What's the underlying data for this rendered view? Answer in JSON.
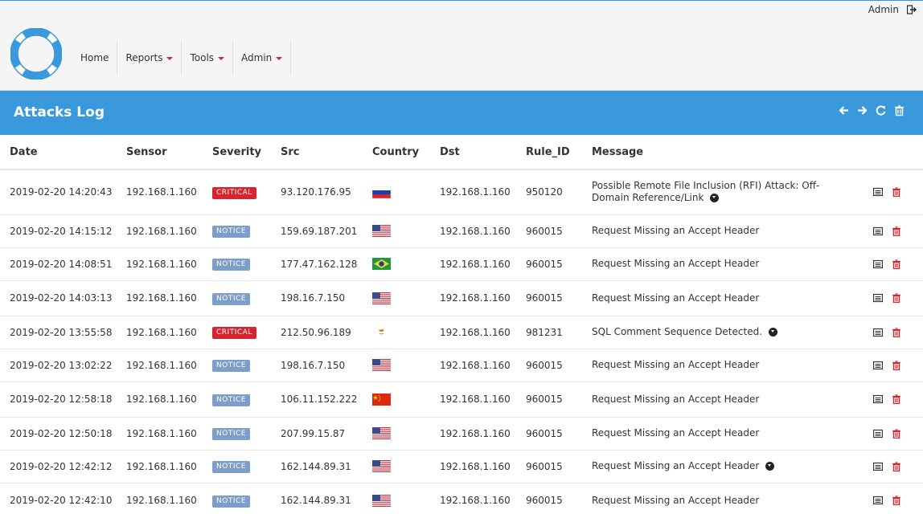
{
  "header": {
    "user": "Admin",
    "nav": [
      {
        "label": "Home",
        "dropdown": false
      },
      {
        "label": "Reports",
        "dropdown": true
      },
      {
        "label": "Tools",
        "dropdown": true
      },
      {
        "label": "Admin",
        "dropdown": true
      }
    ]
  },
  "panel": {
    "title": "Attacks Log",
    "tools": [
      "arrow-left-icon",
      "arrow-right-icon",
      "refresh-icon",
      "trash-icon"
    ]
  },
  "table": {
    "columns": [
      "Date",
      "Sensor",
      "Severity",
      "Src",
      "Country",
      "Dst",
      "Rule_ID",
      "Message"
    ],
    "rows": [
      {
        "date": "2019-02-20 14:20:43",
        "sensor": "192.168.1.160",
        "severity": "CRITICAL",
        "src": "93.120.176.95",
        "country": "ru",
        "dst": "192.168.1.160",
        "rule": "950120",
        "message": "Possible Remote File Inclusion (RFI) Attack: Off-Domain Reference/Link",
        "expand": true
      },
      {
        "date": "2019-02-20 14:15:12",
        "sensor": "192.168.1.160",
        "severity": "NOTICE",
        "src": "159.69.187.201",
        "country": "us",
        "dst": "192.168.1.160",
        "rule": "960015",
        "message": "Request Missing an Accept Header",
        "expand": false
      },
      {
        "date": "2019-02-20 14:08:51",
        "sensor": "192.168.1.160",
        "severity": "NOTICE",
        "src": "177.47.162.128",
        "country": "br",
        "dst": "192.168.1.160",
        "rule": "960015",
        "message": "Request Missing an Accept Header",
        "expand": false
      },
      {
        "date": "2019-02-20 14:03:13",
        "sensor": "192.168.1.160",
        "severity": "NOTICE",
        "src": "198.16.7.150",
        "country": "us",
        "dst": "192.168.1.160",
        "rule": "960015",
        "message": "Request Missing an Accept Header",
        "expand": false
      },
      {
        "date": "2019-02-20 13:55:58",
        "sensor": "192.168.1.160",
        "severity": "CRITICAL",
        "src": "212.50.96.189",
        "country": "cy",
        "dst": "192.168.1.160",
        "rule": "981231",
        "message": "SQL Comment Sequence Detected.",
        "expand": true
      },
      {
        "date": "2019-02-20 13:02:22",
        "sensor": "192.168.1.160",
        "severity": "NOTICE",
        "src": "198.16.7.150",
        "country": "us",
        "dst": "192.168.1.160",
        "rule": "960015",
        "message": "Request Missing an Accept Header",
        "expand": false
      },
      {
        "date": "2019-02-20 12:58:18",
        "sensor": "192.168.1.160",
        "severity": "NOTICE",
        "src": "106.11.152.222",
        "country": "cn",
        "dst": "192.168.1.160",
        "rule": "960015",
        "message": "Request Missing an Accept Header",
        "expand": false
      },
      {
        "date": "2019-02-20 12:50:18",
        "sensor": "192.168.1.160",
        "severity": "NOTICE",
        "src": "207.99.15.87",
        "country": "us",
        "dst": "192.168.1.160",
        "rule": "960015",
        "message": "Request Missing an Accept Header",
        "expand": false
      },
      {
        "date": "2019-02-20 12:42:12",
        "sensor": "192.168.1.160",
        "severity": "NOTICE",
        "src": "162.144.89.31",
        "country": "us",
        "dst": "192.168.1.160",
        "rule": "960015",
        "message": "Request Missing an Accept Header",
        "expand": true
      },
      {
        "date": "2019-02-20 12:42:10",
        "sensor": "192.168.1.160",
        "severity": "NOTICE",
        "src": "162.144.89.31",
        "country": "us",
        "dst": "192.168.1.160",
        "rule": "960015",
        "message": "Request Missing an Accept Header",
        "expand": false
      }
    ]
  },
  "colors": {
    "accent": "#3a99dc",
    "critical": "#d9232e",
    "notice": "#7c9ec9",
    "delete": "#d9232e"
  }
}
